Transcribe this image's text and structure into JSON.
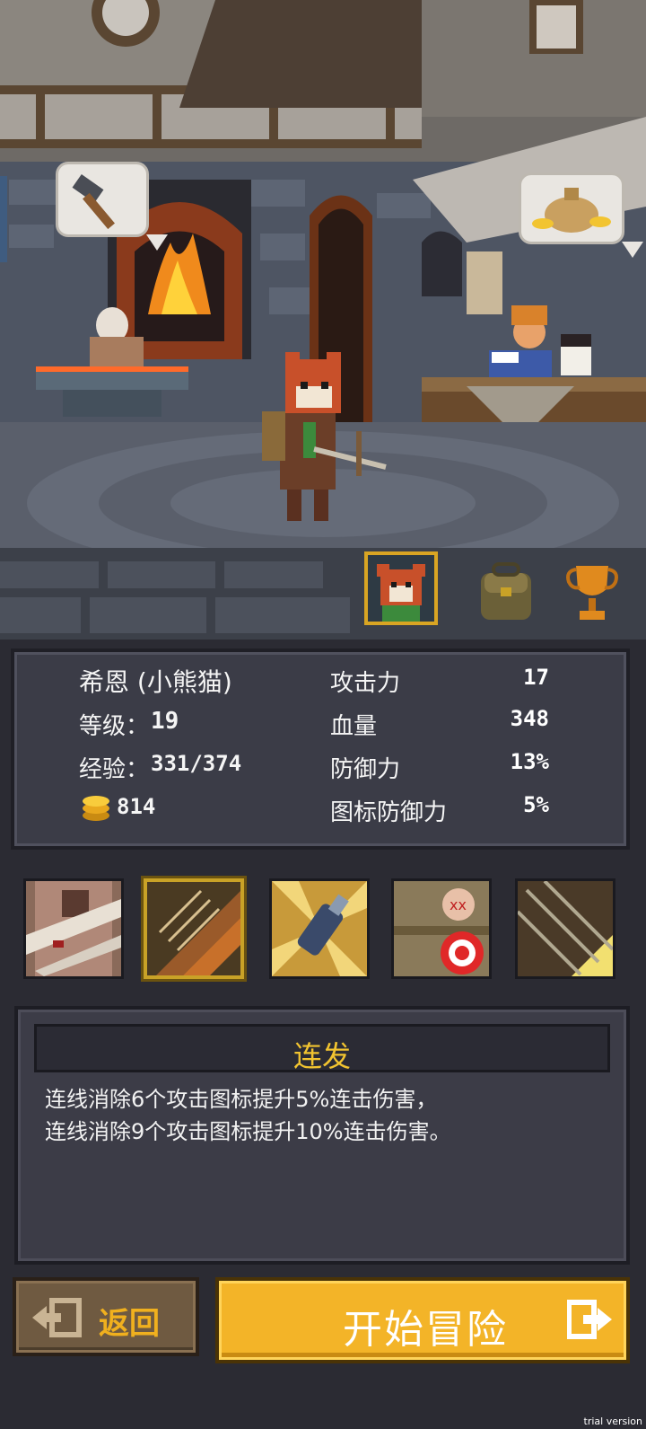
{
  "character": {
    "name": "希恩 (小熊猫)",
    "level_label": "等级：",
    "level": "19",
    "exp_label": "经验：",
    "exp": "331/374",
    "gold": "814"
  },
  "stats": [
    {
      "label": "攻击力",
      "value": "17"
    },
    {
      "label": "血量",
      "value": "348"
    },
    {
      "label": "防御力",
      "value": "13%"
    },
    {
      "label": "图标防御力",
      "value": "5%"
    }
  ],
  "tabs": {
    "character": "character-portrait-icon",
    "bag": "backpack-icon",
    "trophy": "trophy-icon"
  },
  "skills": [
    {
      "icon": "bandaged-brute-icon",
      "selected": false
    },
    {
      "icon": "multi-arrow-icon",
      "selected": true
    },
    {
      "icon": "bottle-icon",
      "selected": false
    },
    {
      "icon": "target-icon",
      "selected": false
    },
    {
      "icon": "volley-arrows-icon",
      "selected": false
    }
  ],
  "skill_detail": {
    "title": "连发",
    "line1": "连线消除6个攻击图标提升5%连击伤害，",
    "line2": "连线消除9个攻击图标提升10%连击伤害。"
  },
  "buttons": {
    "back": "返回",
    "start": "开始冒险"
  },
  "watermark": "trial version",
  "colors": {
    "accent_gold": "#f3b428",
    "title_yellow": "#f2c430",
    "panel": "#3b3c47"
  }
}
